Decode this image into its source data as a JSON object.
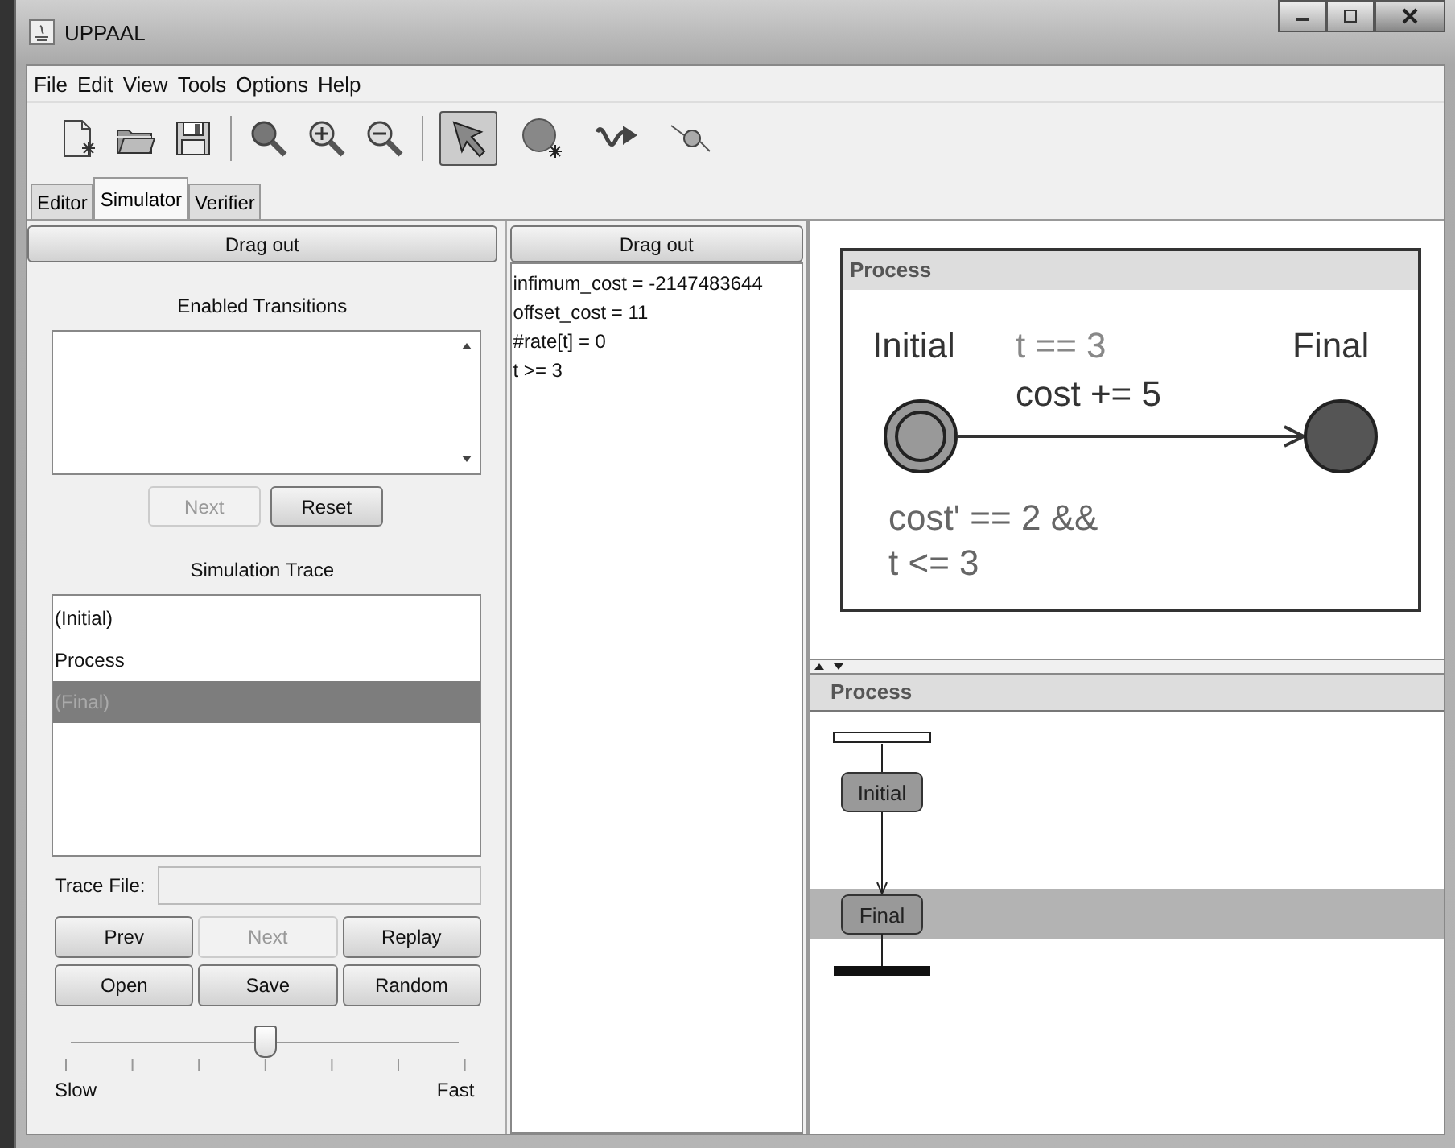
{
  "window": {
    "title": "UPPAAL"
  },
  "menu": [
    "File",
    "Edit",
    "View",
    "Tools",
    "Options",
    "Help"
  ],
  "file_tools": [
    {
      "kind": "new"
    },
    {
      "kind": "open"
    },
    {
      "kind": "save"
    }
  ],
  "view_tools": [
    {
      "kind": "zoom"
    },
    {
      "kind": "zoom_in"
    },
    {
      "kind": "zoom_out"
    }
  ],
  "edit_tools": [
    {
      "kind": "select",
      "selected": true
    },
    {
      "kind": "location",
      "selected": false
    },
    {
      "kind": "edge",
      "selected": false
    },
    {
      "kind": "nail",
      "selected": false
    }
  ],
  "tabs": [
    {
      "label": "Editor",
      "selected": false
    },
    {
      "label": "Simulator",
      "selected": true
    },
    {
      "label": "Verifier",
      "selected": false
    }
  ],
  "left_panel": {
    "drag_out": "Drag out",
    "enabled_transitions": {
      "title": "Enabled Transitions"
    },
    "transition_buttons": [
      {
        "label": "Next",
        "disabled": true
      },
      {
        "label": "Reset",
        "disabled": false
      }
    ],
    "simulation_trace": {
      "title": "Simulation Trace",
      "items": [
        {
          "label": "(Initial)",
          "selected": false
        },
        {
          "label": "Process",
          "selected": false
        },
        {
          "label": "(Final)",
          "selected": true
        }
      ]
    },
    "trace_file": {
      "label": "Trace File:"
    },
    "trace_buttons": [
      {
        "label": "Prev",
        "disabled": false
      },
      {
        "label": "Next",
        "disabled": true
      },
      {
        "label": "Replay",
        "disabled": false
      },
      {
        "label": "Open",
        "disabled": false
      },
      {
        "label": "Save",
        "disabled": false
      },
      {
        "label": "Random",
        "disabled": false
      }
    ],
    "speed": {
      "level": 0.5,
      "min_label": "Slow",
      "max_label": "Fast"
    }
  },
  "variables_panel": {
    "drag_out": "Drag out",
    "lines": [
      "infimum_cost = -2147483644",
      "offset_cost = 11",
      "#rate[t] = 0",
      "t >= 3"
    ]
  },
  "automaton": {
    "title": "Process",
    "locations": [
      {
        "name": "Initial",
        "initial": true,
        "current": false
      },
      {
        "name": "Final",
        "initial": false,
        "current": true
      }
    ],
    "guard": "t == 3",
    "update": "cost += 5",
    "invariant": [
      "cost' == 2 &&",
      "t <= 3"
    ]
  },
  "sequence_chart": {
    "title": "Process",
    "states": [
      {
        "label": "Initial",
        "selected": false
      },
      {
        "label": "Final",
        "selected": true
      }
    ]
  }
}
